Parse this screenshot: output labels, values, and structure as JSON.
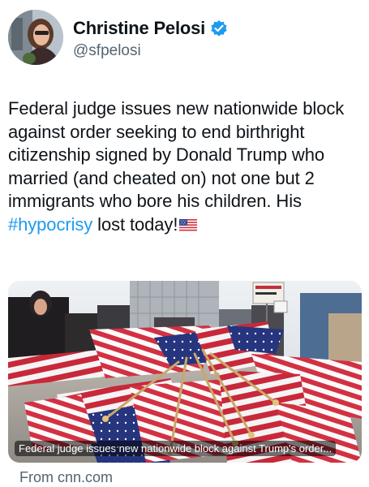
{
  "author": {
    "display_name": "Christine Pelosi",
    "handle": "@sfpelosi",
    "verified": true,
    "verified_color": "#1d9bf0"
  },
  "tweet": {
    "text_before": "Federal judge issues new nationwide block against order seeking to end birthright citizenship signed by Donald Trump who married (and cheated on) not one but 2 immigrants who bore his children. His ",
    "hashtag": "#hypocrisy",
    "text_after": " lost today!",
    "emoji": "us-flag-emoji"
  },
  "link_card": {
    "caption": "Federal judge issues new nationwide block against Trump's order...",
    "source": "From cnn.com",
    "image": "photo of many small american flags laid on pavement with protesters"
  },
  "colors": {
    "hashtag": "#1d9bf0",
    "secondary_text": "#536471"
  }
}
